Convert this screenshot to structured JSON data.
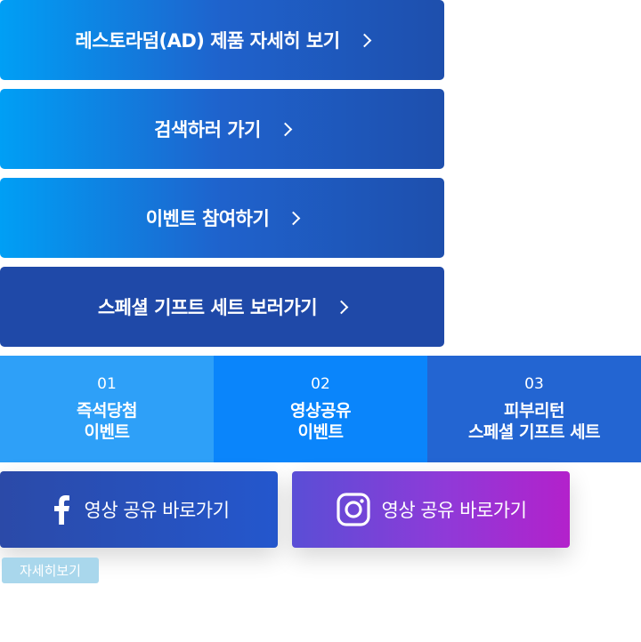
{
  "buttons": [
    {
      "label": "레스토라덤(AD) 제품 자세히 보기"
    },
    {
      "label": "검색하러 가기"
    },
    {
      "label": "이벤트 참여하기"
    },
    {
      "label": "스페셜 기프트 세트 보러가기"
    }
  ],
  "tabs": [
    {
      "num": "01",
      "line1": "즉석당첨",
      "line2": "이벤트"
    },
    {
      "num": "02",
      "line1": "영상공유",
      "line2": "이벤트"
    },
    {
      "num": "03",
      "line1": "피부리턴",
      "line2": "스페셜 기프트 세트"
    }
  ],
  "share": {
    "facebook_label": "영상 공유 바로가기",
    "instagram_label": "영상 공유 바로가기"
  },
  "detail_label": "자세히보기",
  "colors": {
    "gradient_start": "#009ff5",
    "gradient_end": "#1e4fad",
    "tab1": "#2ea0f8",
    "tab2": "#0a85fb",
    "tab3": "#2365d2",
    "instagram_end": "#b321cb",
    "detail_bg": "#a9d7ec"
  },
  "icons": {
    "chevron": "chevron-right-icon",
    "facebook": "facebook-icon",
    "instagram": "instagram-icon"
  }
}
